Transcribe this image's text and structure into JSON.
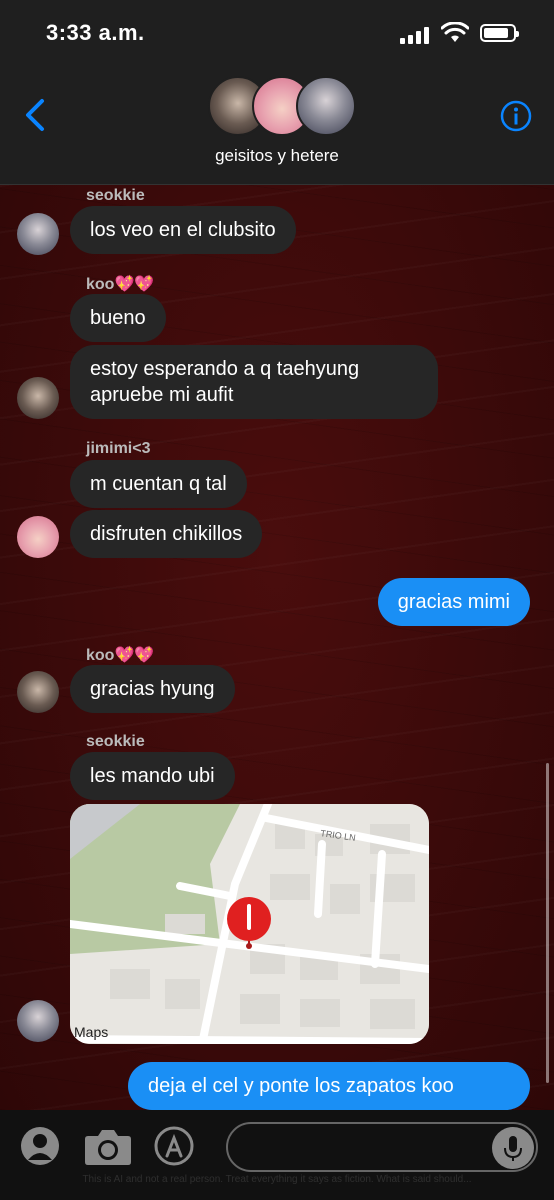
{
  "status_bar": {
    "time": "3:33 a.m."
  },
  "header": {
    "group_name": "geisitos y hetere"
  },
  "messages": [
    {
      "sender": "seokkie",
      "text": "los veo en el clubsito"
    },
    {
      "sender": "koo💖💖",
      "text": "bueno"
    },
    {
      "text": "estoy esperando a q taehyung apruebe mi aufit"
    },
    {
      "sender": "jimimi<3",
      "text": "m cuentan q tal"
    },
    {
      "text": "disfruten chikillos"
    },
    {
      "text": "gracias mimi"
    },
    {
      "sender": "koo💖💖",
      "text": "gracias hyung"
    },
    {
      "sender": "seokkie",
      "text": "les mando ubi"
    },
    {
      "text": "deja el cel y ponte los zapatos koo"
    }
  ],
  "map": {
    "street_label": "TRIO LN",
    "attribution": "Maps",
    "pin_color": "#e02020"
  },
  "footer": {
    "watermark": "This is AI and not a real person. Treat everything it says as fiction. What is said should..."
  },
  "colors": {
    "incoming": "#262626",
    "outgoing": "#1a8ff5",
    "accent": "#0a84ff",
    "chat_bg": "#3a0a0a"
  }
}
